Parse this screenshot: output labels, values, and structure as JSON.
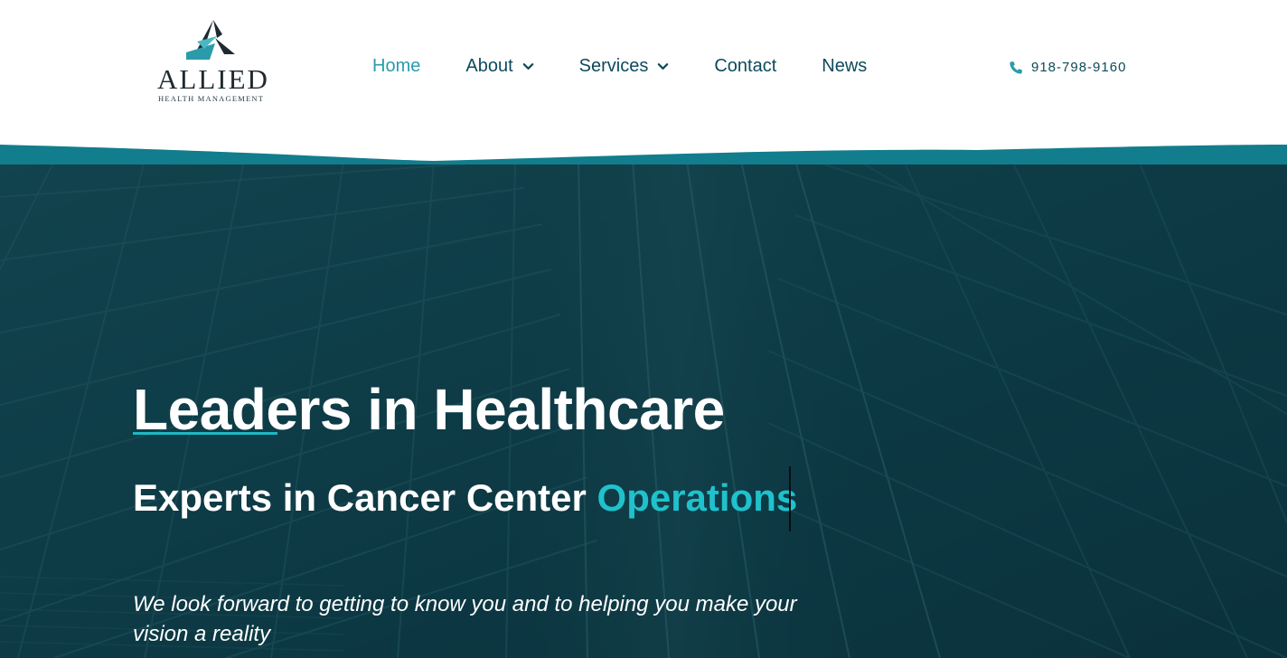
{
  "brand": {
    "name": "ALLIED",
    "tagline": "HEALTH MANAGEMENT"
  },
  "nav": {
    "items": [
      {
        "label": "Home",
        "active": true,
        "dropdown": false
      },
      {
        "label": "About",
        "active": false,
        "dropdown": true
      },
      {
        "label": "Services",
        "active": false,
        "dropdown": true
      },
      {
        "label": "Contact",
        "active": false,
        "dropdown": false
      },
      {
        "label": "News",
        "active": false,
        "dropdown": false
      }
    ]
  },
  "contact": {
    "phone": "918-798-9160",
    "icon": "phone-icon"
  },
  "hero": {
    "title": "Leaders in Healthcare",
    "subtitle_prefix": "Experts in Cancer Center",
    "subtitle_highlight": "Operations",
    "body": "We look forward to getting to know you and to helping you make your vision a reality"
  },
  "colors": {
    "primary": "#0d4a5c",
    "accent": "#1fc2cc",
    "active_nav": "#2b9bab",
    "hero_overlay": "#0d3a43",
    "wave": "#127d8c"
  }
}
